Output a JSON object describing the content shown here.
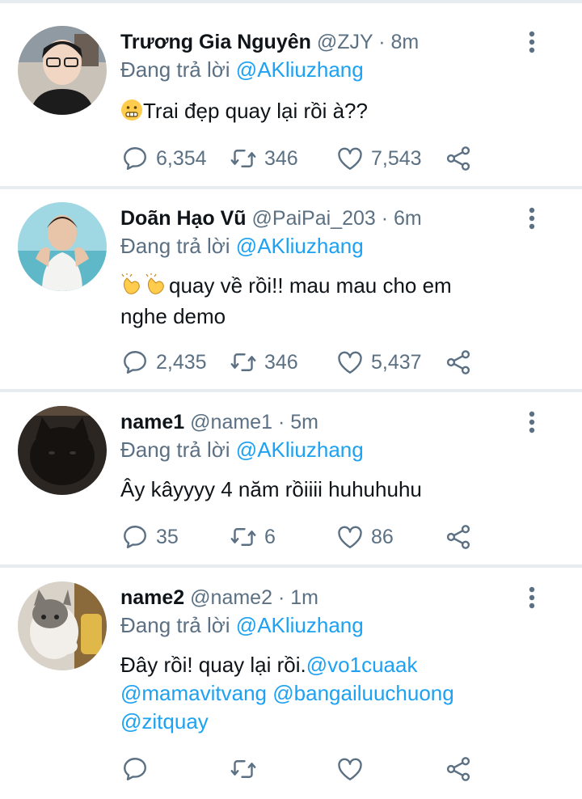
{
  "replies": [
    {
      "name": "Trương Gia Nguyên",
      "handle": "@ZJY",
      "dot": "·",
      "time": "8m",
      "replying_prefix": "Đang trả lời",
      "replying_to": "@AKliuzhang",
      "text": "Trai đẹp quay lại rồi à??",
      "emoji": "grimacing-face-icon",
      "reply_count": "6,354",
      "retweet_count": "346",
      "like_count": "7,543"
    },
    {
      "name": "Doãn Hạo Vũ",
      "handle": "@PaiPai_203",
      "dot": "·",
      "time": "6m",
      "replying_prefix": "Đang trả lời",
      "replying_to": "@AKliuzhang",
      "text_line1": "quay về rồi!! mau mau cho em",
      "text_line2": "nghe demo",
      "emoji": "clapping-hands-icon",
      "reply_count": "2,435",
      "retweet_count": "346",
      "like_count": "5,437"
    },
    {
      "name": "name1",
      "handle": "@name1",
      "dot": "·",
      "time": "5m",
      "replying_prefix": "Đang trả lời",
      "replying_to": "@AKliuzhang",
      "text": "Ây kâyyyy 4 năm rồiiii huhuhuhu",
      "reply_count": "35",
      "retweet_count": "6",
      "like_count": "86"
    },
    {
      "name": "name2",
      "handle": "@name2",
      "dot": "·",
      "time": "1m",
      "replying_prefix": "Đang trả lời",
      "replying_to": "@AKliuzhang",
      "text_line1_plain": "Đây rồi! quay lại rồi.",
      "text_line1_mention": "@vo1cuaak",
      "text_line2_a": "@mamavitvang",
      "text_line2_b": "@bangailuuchuong",
      "text_line3": "@zitquay",
      "reply_count": "",
      "retweet_count": "",
      "like_count": ""
    }
  ],
  "colors": {
    "text": "#0f1419",
    "secondary": "#5b7083",
    "link": "#1da1f2",
    "divider": "#e6ecf0"
  }
}
